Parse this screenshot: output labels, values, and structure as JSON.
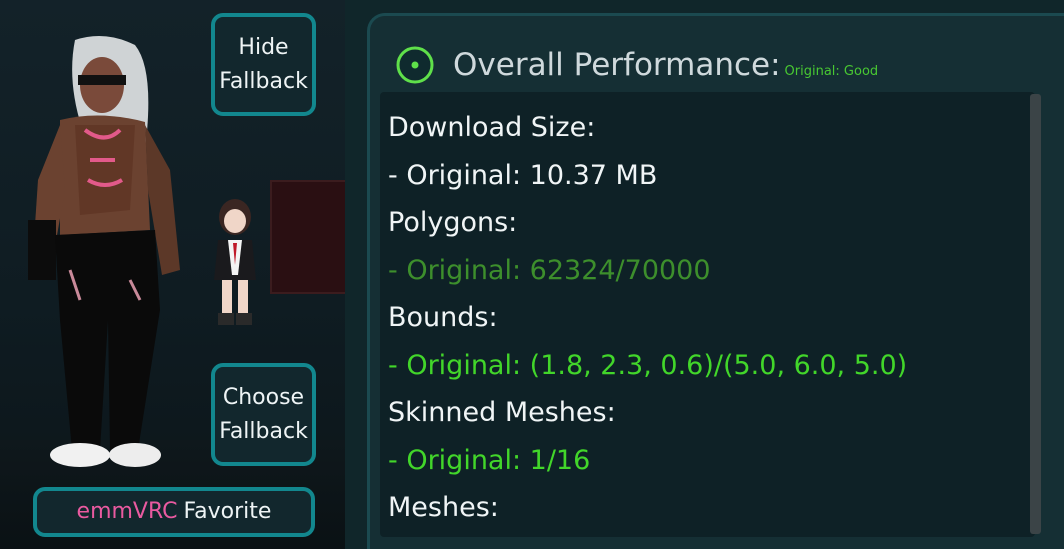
{
  "buttons": {
    "hide_fallback": [
      "Hide",
      "Fallback"
    ],
    "choose_fallback": [
      "Choose",
      "Fallback"
    ],
    "favorite_brand": "emmVRC",
    "favorite_label": "Favorite"
  },
  "panel": {
    "title": "Overall Performance:",
    "rating": "Original: Good",
    "stats": [
      {
        "label": "Download Size:",
        "value": "- Original: 10.37 MB",
        "tone": "white"
      },
      {
        "label": "Polygons:",
        "value": "- Original: 62324/70000",
        "tone": "dim"
      },
      {
        "label": "Bounds:",
        "value": "- Original: (1.8, 2.3, 0.6)/(5.0, 6.0, 5.0)",
        "tone": "green"
      },
      {
        "label": "Skinned Meshes:",
        "value": "- Original: 1/16",
        "tone": "green"
      },
      {
        "label": "Meshes:",
        "value": "",
        "tone": "white"
      }
    ]
  },
  "colors": {
    "accent": "#12878e",
    "good": "#42d62a",
    "medium": "#3d8f2c",
    "brand": "#e95aa0"
  },
  "icons": [
    "status-good-icon"
  ]
}
